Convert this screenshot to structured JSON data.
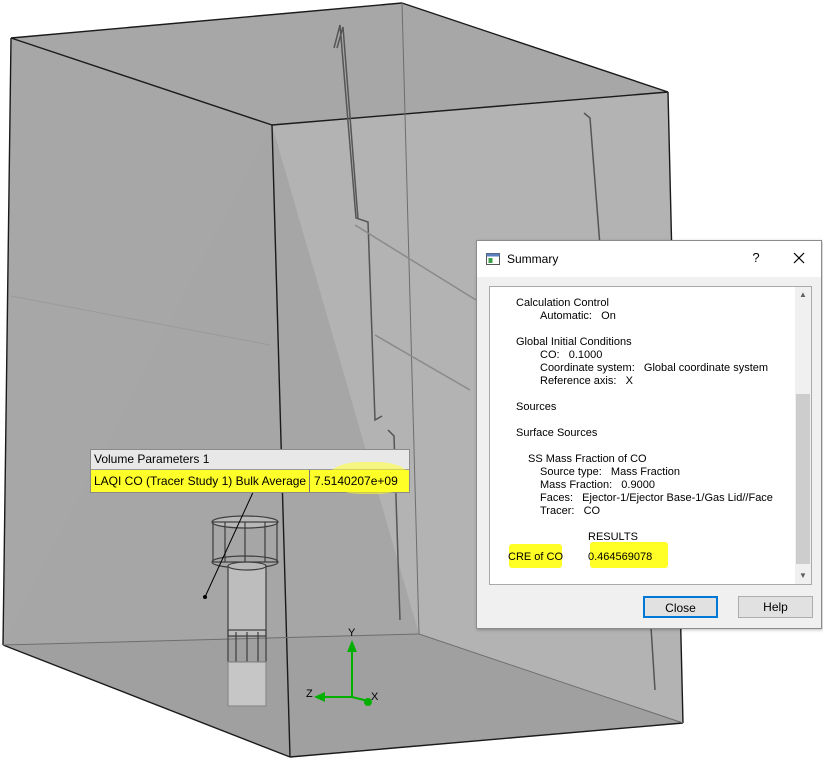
{
  "scene": {
    "axis_labels": {
      "y": "Y",
      "z": "Z",
      "x": "X"
    }
  },
  "volume_parameters": {
    "title": "Volume Parameters 1",
    "label": "LAQI CO (Tracer Study 1) Bulk Average",
    "value": "7.5140207e+09",
    "highlight_color": "#ffff29"
  },
  "summary_dialog": {
    "title": "Summary",
    "help_glyph": "?",
    "lines": [
      "Calculation Control",
      "Automatic:   On",
      "Global Initial Conditions",
      "CO:   0.1000",
      "Coordinate system:   Global coordinate system",
      "Reference axis:   X",
      "Sources",
      "Surface Sources",
      "SS Mass Fraction of CO",
      "Source type:   Mass Fraction",
      "Mass Fraction:   0.9000",
      "Faces:   Ejector-1/Ejector Base-1/Gas Lid//Face",
      "Tracer:   CO",
      "RESULTS"
    ],
    "result_label": "CRE of CO",
    "result_value": "0.464569078",
    "buttons": {
      "close": "Close",
      "help": "Help"
    }
  }
}
